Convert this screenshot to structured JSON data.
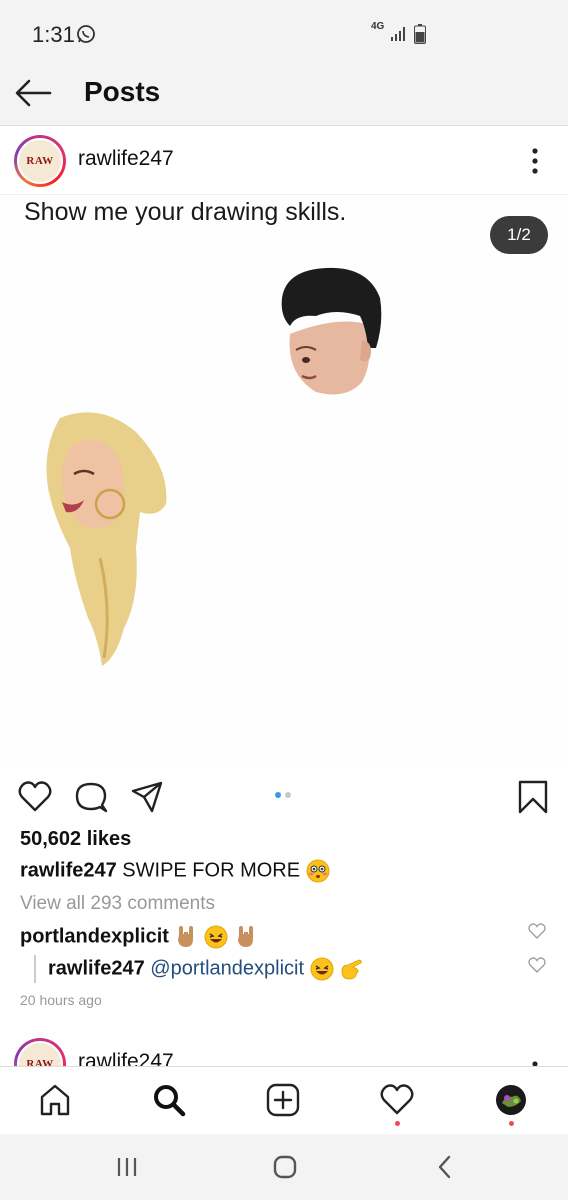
{
  "status_bar": {
    "time": "1:31",
    "network": "4G",
    "icons": [
      "whatsapp-icon",
      "signal-icon",
      "battery-icon"
    ]
  },
  "top_bar": {
    "title": "Posts",
    "back_icon": "arrow-left-icon"
  },
  "post": {
    "username": "rawlife247",
    "avatar_text": "RAW",
    "image_caption": "Show me your drawing skills.",
    "page_indicator": "1/2",
    "carousel": {
      "total": 2,
      "current": 1
    },
    "likes": "50,602 likes",
    "caption": {
      "username": "rawlife247",
      "text": "SWIPE FOR MORE"
    },
    "view_comments": "View all 293 comments",
    "comments": [
      {
        "username": "portlandexplicit",
        "text": ""
      },
      {
        "username": "rawlife247",
        "mention": "@portlandexplicit"
      }
    ],
    "timestamp": "20 hours ago"
  },
  "next_post": {
    "username": "rawlife247"
  },
  "bottom_nav": {
    "items": [
      "home-icon",
      "search-icon",
      "add-post-icon",
      "activity-icon",
      "profile-icon"
    ]
  },
  "system_nav": {
    "items": [
      "recent-apps-icon",
      "home-button-icon",
      "back-button-icon"
    ]
  },
  "colors": {
    "accent": "#3897f0",
    "notification": "#ed4956",
    "mention": "#234e7e",
    "badge": "#3b3b3b"
  }
}
